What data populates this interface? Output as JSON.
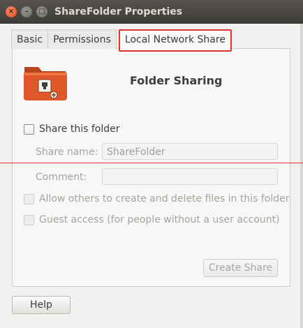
{
  "window": {
    "title": "ShareFolder Properties",
    "close_glyph": "×",
    "minimize_glyph": "–",
    "maximize_glyph": "□"
  },
  "tabs": [
    {
      "label": "Basic"
    },
    {
      "label": "Permissions"
    },
    {
      "label": "Local Network Share",
      "active": true
    }
  ],
  "sharing": {
    "heading": "Folder Sharing",
    "share_folder_label": "Share this folder",
    "share_folder_checked": false,
    "share_name_label": "Share name:",
    "share_name_value": "ShareFolder",
    "comment_label": "Comment:",
    "comment_value": "",
    "allow_others_label": "Allow others to create and delete files in this folder",
    "guest_access_label": "Guest access (for people without a user account)",
    "create_share_label": "Create Share"
  },
  "footer": {
    "help_label": "Help"
  },
  "colors": {
    "titlebar": "#3e3c38",
    "folder_orange": "#e0582a",
    "highlight_red": "#e03030"
  }
}
